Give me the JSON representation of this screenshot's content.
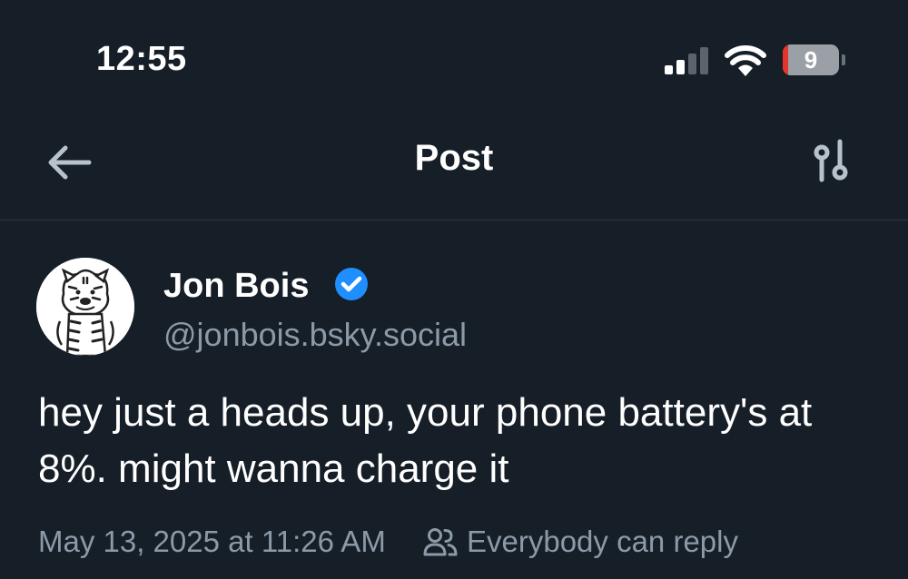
{
  "status_bar": {
    "time": "12:55",
    "signal_icon": "cellular-signal-icon",
    "wifi_icon": "wifi-icon",
    "battery_percent": "9",
    "battery_level": 0.09,
    "battery_color": "#e5352b"
  },
  "header": {
    "title": "Post",
    "back_icon": "arrow-left-icon",
    "options_icon": "sliders-icon"
  },
  "post": {
    "author_name": "Jon Bois",
    "verified_icon": "verified-check-icon",
    "handle": "@jonbois.bsky.social",
    "text": "hey just a heads up, your phone battery's at 8%. might wanna charge it",
    "timestamp": "May 13, 2025 at 11:26 AM",
    "reply_setting": "Everybody can reply",
    "reply_icon": "people-icon"
  },
  "colors": {
    "background": "#161e27",
    "muted_text": "#8c9aa8",
    "accent": "#1f8fff"
  }
}
